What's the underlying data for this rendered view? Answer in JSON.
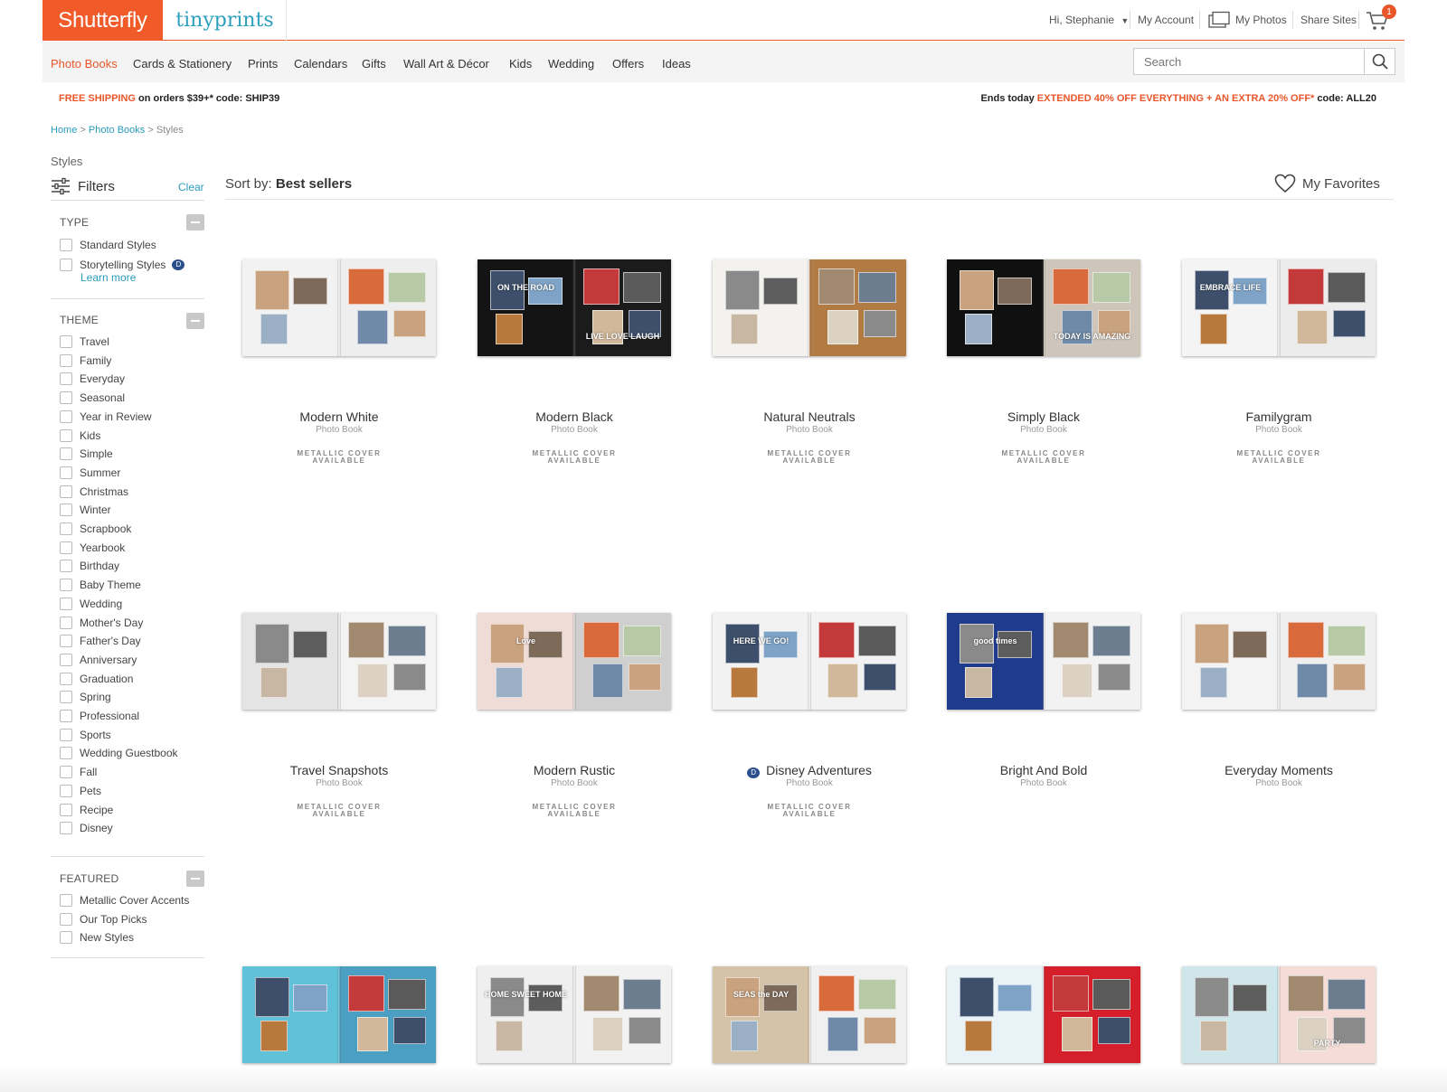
{
  "header": {
    "brand_primary": "Shutterfly",
    "brand_secondary": "tinyprints",
    "greeting": "Hi, Stephanie",
    "my_account": "My Account",
    "my_photos": "My Photos",
    "share_sites": "Share Sites",
    "cart_count": "1",
    "accent_color": "#e8562a"
  },
  "nav": {
    "items": [
      "Photo Books",
      "Cards & Stationery",
      "Prints",
      "Calendars",
      "Gifts",
      "Wall Art & Décor",
      "Kids",
      "Wedding",
      "Offers",
      "Ideas"
    ],
    "active": "Photo Books"
  },
  "search": {
    "placeholder": "Search"
  },
  "promo": {
    "left_highlight": "FREE SHIPPING",
    "left_text": " on orders $39+* code: SHIP39",
    "right_prefix": "Ends today ",
    "right_highlight": "EXTENDED 40% OFF EVERYTHING + AN EXTRA 20% OFF*",
    "right_suffix": " code: ALL20"
  },
  "breadcrumb": {
    "home": "Home",
    "sep": " > ",
    "section": "Photo Books",
    "current": "Styles"
  },
  "sidebar": {
    "title": "Styles",
    "filters_label": "Filters",
    "clear_label": "Clear",
    "type": {
      "title": "TYPE",
      "options": [
        "Standard Styles",
        "Storytelling Styles"
      ],
      "learn_more": "Learn more"
    },
    "theme": {
      "title": "THEME",
      "options": [
        "Travel",
        "Family",
        "Everyday",
        "Seasonal",
        "Year in Review",
        "Kids",
        "Simple",
        "Summer",
        "Christmas",
        "Winter",
        "Scrapbook",
        "Yearbook",
        "Birthday",
        "Baby Theme",
        "Wedding",
        "Mother's Day",
        "Father's Day",
        "Anniversary",
        "Graduation",
        "Spring",
        "Professional",
        "Sports",
        "Wedding Guestbook",
        "Fall",
        "Pets",
        "Recipe",
        "Disney"
      ]
    },
    "featured": {
      "title": "FEATURED",
      "options": [
        "Metallic Cover Accents",
        "Our Top Picks",
        "New Styles"
      ]
    }
  },
  "sort": {
    "label": "Sort by: ",
    "value": "Best sellers"
  },
  "favorites": {
    "label": "My Favorites"
  },
  "product_meta": {
    "type_label": "Photo Book",
    "metallic_line1": "METALLIC COVER",
    "metallic_line2": "AVAILABLE"
  },
  "products": [
    {
      "name": "Modern White",
      "metallic": true,
      "left_bg": "#f2f2f2",
      "right_bg": "#eeeeee"
    },
    {
      "name": "Modern Black",
      "metallic": true,
      "left_bg": "#141414",
      "right_bg": "#1b1b1b",
      "left_text": "ON THE ROAD",
      "right_text": "LIVE LOVE LAUGH"
    },
    {
      "name": "Natural Neutrals",
      "metallic": true,
      "left_bg": "#f4f2ef",
      "right_bg": "#b27b44"
    },
    {
      "name": "Simply Black",
      "metallic": true,
      "left_bg": "#101010",
      "right_bg": "#cfc6bb",
      "right_text": "TODAY IS AMAZING"
    },
    {
      "name": "Familygram",
      "metallic": true,
      "left_bg": "#f4f4f4",
      "right_bg": "#ececec",
      "left_text": "EMBRACE LIFE"
    },
    {
      "name": "Travel Snapshots",
      "metallic": true,
      "left_bg": "#e4e4e4",
      "right_bg": "#f3f3f3"
    },
    {
      "name": "Modern Rustic",
      "metallic": true,
      "left_bg": "#f0dcd6",
      "right_bg": "#cfcfcf",
      "left_text": "Love"
    },
    {
      "name": "Disney Adventures",
      "metallic": true,
      "disney": true,
      "left_bg": "#f2f2f2",
      "right_bg": "#f2f2f2",
      "left_text": "HERE WE GO!"
    },
    {
      "name": "Bright And Bold",
      "metallic": false,
      "left_bg": "#1e3b8c",
      "right_bg": "#f2f2f2",
      "left_text": "good times"
    },
    {
      "name": "Everyday Moments",
      "metallic": false,
      "left_bg": "#f3f3f3",
      "right_bg": "#efefef"
    },
    {
      "left_bg": "#5fc2d8",
      "right_bg": "#4a9fc3"
    },
    {
      "left_bg": "#efefef",
      "right_bg": "#f2f2f2",
      "left_text": "HOME SWEET HOME"
    },
    {
      "left_bg": "#d5c3a8",
      "right_bg": "#f0f0f0",
      "left_text": "SEAS the DAY"
    },
    {
      "left_bg": "#e8f2f7",
      "right_bg": "#d51f2a"
    },
    {
      "left_bg": "#cfe7ea",
      "right_bg": "#f6dcd7",
      "right_text": "PARTY"
    }
  ]
}
